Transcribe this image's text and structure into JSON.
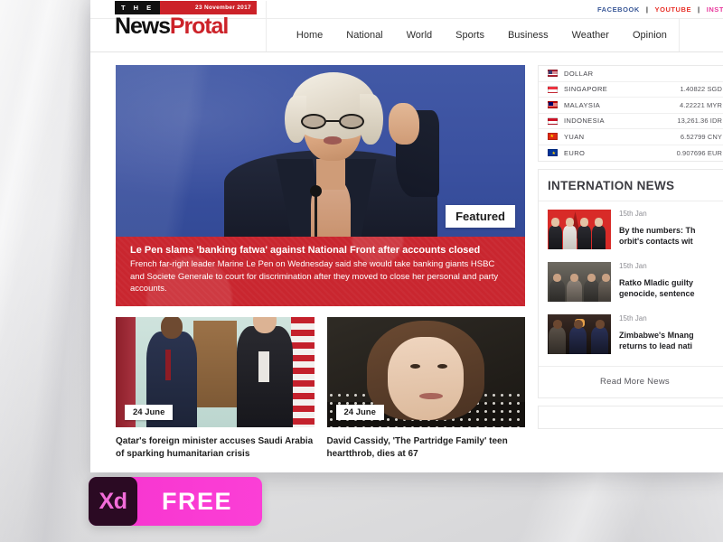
{
  "topbar": {
    "social": [
      {
        "label": "FACEBOOK",
        "color": "#3b5998"
      },
      {
        "label": "YOUTUBE",
        "color": "#e8322a"
      },
      {
        "label": "INST",
        "color": "#e8389c"
      }
    ],
    "separator": "|"
  },
  "brand": {
    "the": "T H E",
    "date": "23 November 2017",
    "name_dark": "News",
    "name_red": "Protal",
    "accent": "#cc2229"
  },
  "nav": {
    "items": [
      {
        "label": "Home"
      },
      {
        "label": "National"
      },
      {
        "label": "World"
      },
      {
        "label": "Sports"
      },
      {
        "label": "Business"
      },
      {
        "label": "Weather"
      },
      {
        "label": "Opinion"
      }
    ]
  },
  "featured": {
    "badge": "Featured",
    "headline": "Le Pen slams 'banking fatwa' against National Front after accounts closed",
    "summary": "French far-right leader Marine Le Pen on Wednesday said she would take banking giants HSBC and Societe Generale to court for discrimination after they moved to close her personal and party accounts.",
    "bg_color": "#c9262f"
  },
  "cards": [
    {
      "date": "24 June",
      "title": "Qatar's foreign minister accuses Saudi Arabia of sparking humanitarian crisis"
    },
    {
      "date": "24 June",
      "title": "David Cassidy, 'The Partridge Family' teen heartthrob, dies at 67"
    }
  ],
  "currency": {
    "rows": [
      {
        "country": "DOLLAR",
        "value": ""
      },
      {
        "country": "SINGAPORE",
        "value": "1.40822 SGD"
      },
      {
        "country": "MALAYSIA",
        "value": "4.22221 MYR"
      },
      {
        "country": "INDONESIA",
        "value": "13,261.36 IDR"
      },
      {
        "country": "YUAN",
        "value": "6.52799 CNY"
      },
      {
        "country": "EURO",
        "value": "0.907696 EUR"
      }
    ]
  },
  "international": {
    "title": "INTERNATION NEWS",
    "items": [
      {
        "date": "15th Jan",
        "title_line1": "By the numbers: Th",
        "title_line2": "orbit's contacts wit"
      },
      {
        "date": "15th Jan",
        "title_line1": "Ratko Mladic guilty",
        "title_line2": "genocide, sentence"
      },
      {
        "date": "15th Jan",
        "title_line1": "Zimbabwe's Mnang",
        "title_line2": "returns to lead nati"
      }
    ],
    "read_more": "Read More News"
  },
  "xd_badge": {
    "mark": "Xd",
    "label": "FREE",
    "color": "#f734cf"
  }
}
